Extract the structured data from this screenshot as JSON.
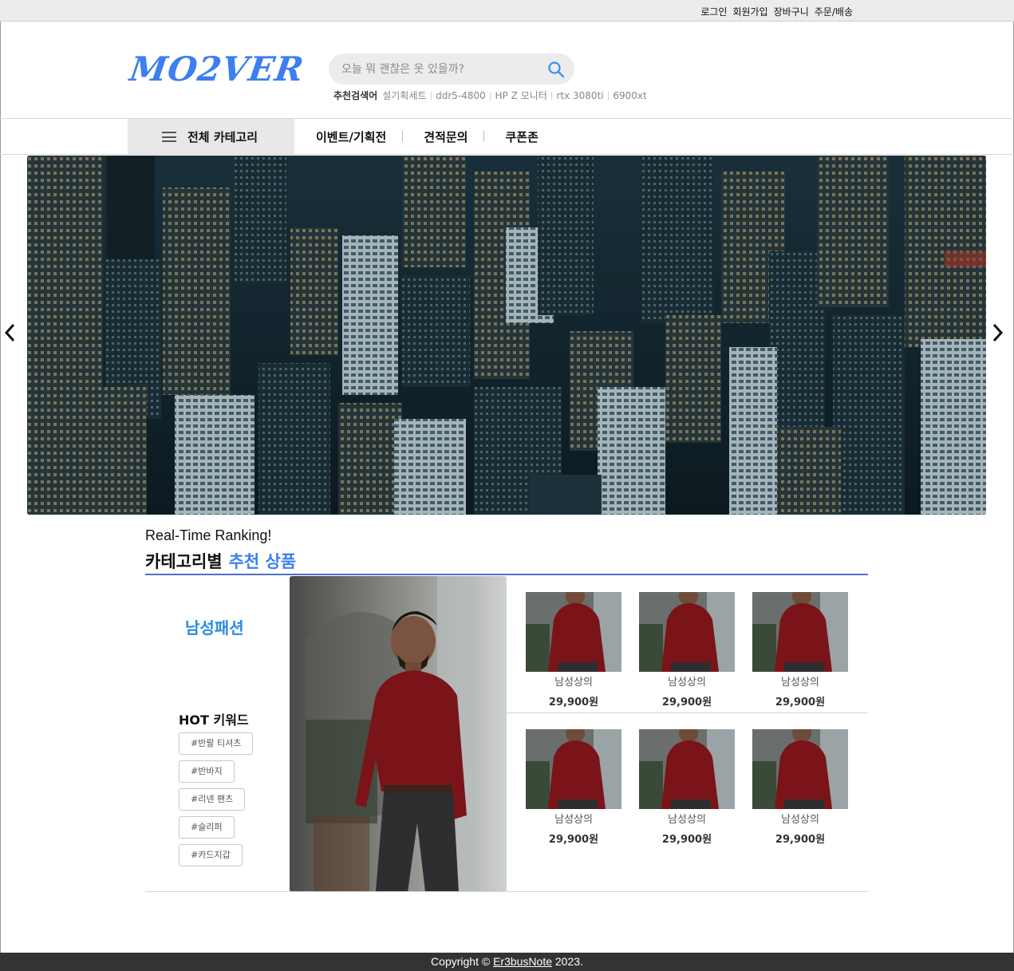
{
  "topbar": {
    "links": [
      "로그인",
      "회원가입",
      "장바구니",
      "주문/배송"
    ]
  },
  "header": {
    "logo": "MO2VER",
    "search_placeholder": "오늘 뭐 괜찮은 옷 있을까?",
    "recommend_label": "추천검색어",
    "recommend_keywords": [
      "설기획세트",
      "ddr5-4800",
      "HP Z 모니터",
      "rtx 3080ti",
      "6900xt"
    ]
  },
  "nav": {
    "all_category": "전체 카테고리",
    "items": [
      "이벤트/기획전",
      "견적문의",
      "쿠폰존"
    ]
  },
  "ranking": {
    "subtitle": "Real-Time Ranking!",
    "title": "카테고리별",
    "title_accent": "추천 상품",
    "category": "남성패션",
    "hot_title": "HOT 키워드",
    "tags": [
      "#반팔 티셔츠",
      "#반바지",
      "#리넨 팬츠",
      "#슬리퍼",
      "#카드지갑"
    ],
    "products": [
      {
        "name": "남성상의",
        "price": "29,900원"
      },
      {
        "name": "남성상의",
        "price": "29,900원"
      },
      {
        "name": "남성상의",
        "price": "29,900원"
      },
      {
        "name": "남성상의",
        "price": "29,900원"
      },
      {
        "name": "남성상의",
        "price": "29,900원"
      },
      {
        "name": "남성상의",
        "price": "29,900원"
      }
    ]
  },
  "footer": {
    "prefix": "Copyright ©",
    "link": "Er3busNote",
    "suffix": "2023."
  },
  "colors": {
    "accent": "#3d7ef0",
    "category": "#2a8be0",
    "footer_bg": "#333333",
    "shirt": "#7a1418"
  },
  "icons": {
    "search": "search-icon",
    "menu": "hamburger-icon",
    "prev": "chevron-left-icon",
    "next": "chevron-right-icon"
  }
}
